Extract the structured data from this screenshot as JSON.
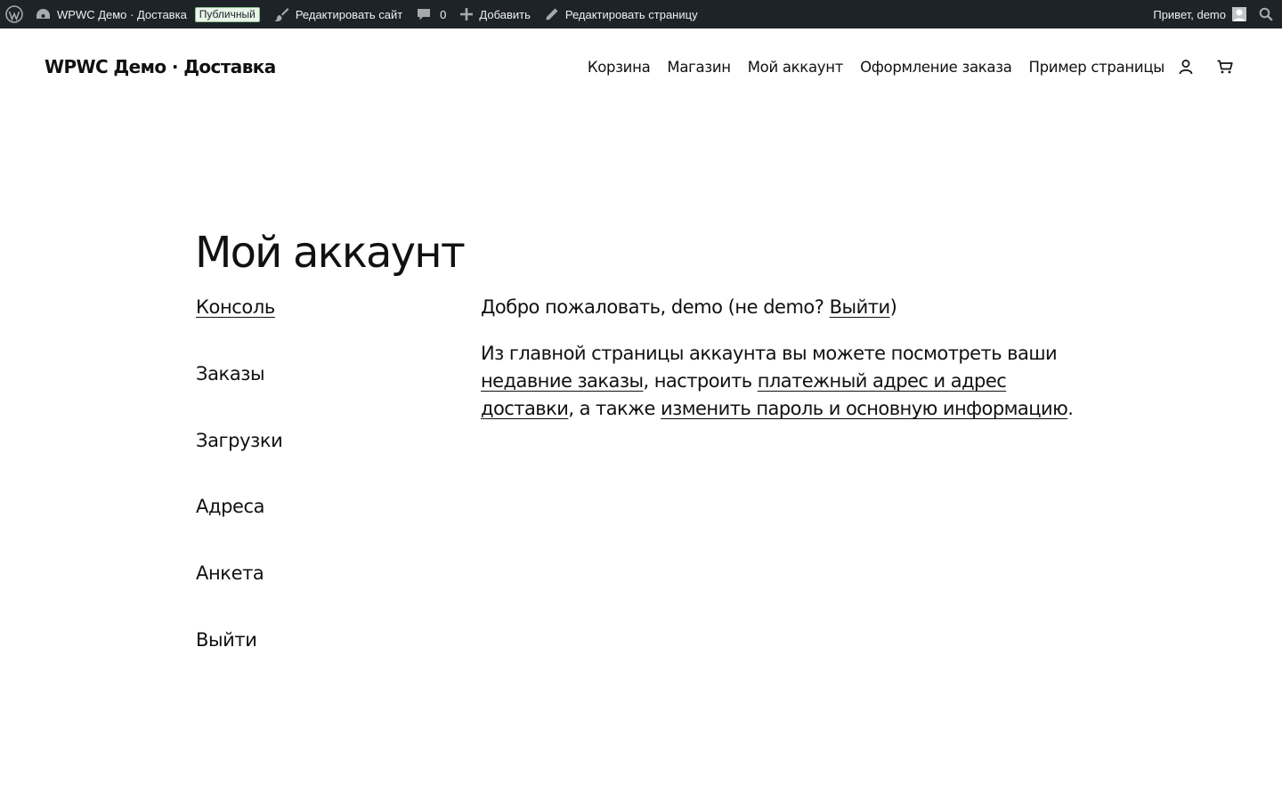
{
  "adminbar": {
    "site_name": "WPWC Демо · Доставка",
    "badge": "Публичный",
    "edit_site": "Редактировать сайт",
    "comments_count": "0",
    "add_new": "Добавить",
    "edit_page": "Редактировать страницу",
    "howdy": "Привет, demo",
    "colors": {
      "background": "#1d2327",
      "text": "#f0f0f1",
      "icon": "#a7aaad",
      "badge_bg": "#eaf5ea"
    }
  },
  "header": {
    "site_title": "WPWC Демо · Доставка",
    "nav": [
      "Корзина",
      "Магазин",
      "Мой аккаунт",
      "Оформление заказа",
      "Пример страницы"
    ],
    "icons": [
      "account-icon",
      "cart-icon"
    ]
  },
  "page": {
    "title": "Мой аккаунт"
  },
  "account_nav": {
    "items": [
      "Консоль",
      "Заказы",
      "Загрузки",
      "Адреса",
      "Анкета",
      "Выйти"
    ],
    "active": "Консоль"
  },
  "content": {
    "greeting_prefix": "Добро пожаловать,",
    "user": "demo",
    "paren_open": "(не",
    "user2": "demo",
    "question": "?",
    "logout_link": "Выйти",
    "paren_close": ")",
    "intro_1": "Из главной страницы аккаунта вы можете посмотреть ваши",
    "orders_link": "недавние заказы",
    "intro_2": ", настроить",
    "addresses_link": "платежный адрес и адрес доставки",
    "intro_3": ", а также",
    "account_link": "изменить пароль и основную информацию",
    "intro_4": "."
  }
}
